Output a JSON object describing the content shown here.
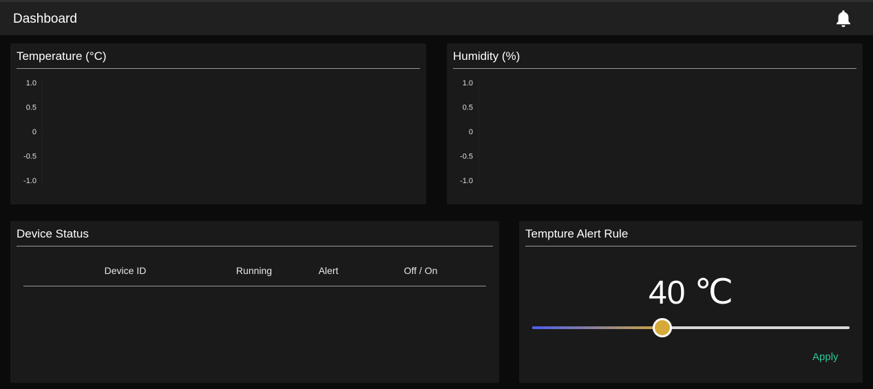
{
  "header": {
    "title": "Dashboard",
    "icon": "bell-icon"
  },
  "temperature": {
    "title": "Temperature (°C)",
    "chart_data": {
      "type": "line",
      "title": "Temperature (°C)",
      "xlabel": "",
      "ylabel": "",
      "ylim": [
        -1.0,
        1.0
      ],
      "y_ticks": [
        "1.0",
        "0.5",
        "0",
        "-0.5",
        "-1.0"
      ],
      "series": []
    }
  },
  "humidity": {
    "title": "Humidity (%)",
    "chart_data": {
      "type": "line",
      "title": "Humidity (%)",
      "xlabel": "",
      "ylabel": "",
      "ylim": [
        -1.0,
        1.0
      ],
      "y_ticks": [
        "1.0",
        "0.5",
        "0",
        "-0.5",
        "-1.0"
      ],
      "series": []
    }
  },
  "device_status": {
    "title": "Device Status",
    "columns": [
      "Device ID",
      "Running",
      "Alert",
      "Off / On"
    ],
    "rows": []
  },
  "alert_rule": {
    "title": "Tempture Alert Rule",
    "value": "40",
    "unit": "℃",
    "slider_fraction": 0.41,
    "apply_label": "Apply",
    "colors": {
      "track_start": "#4d5ff0",
      "thumb": "#d5aa3a",
      "apply": "#2bc99a"
    }
  }
}
